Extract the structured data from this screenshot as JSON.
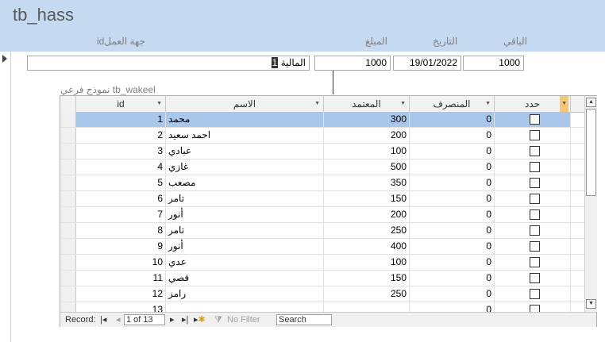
{
  "form": {
    "title": "tb_hass",
    "labels": {
      "id_entity": "جهة العملid",
      "amount": "المبلغ",
      "date": "التاريخ",
      "remaining": "الباقي"
    },
    "fields": {
      "id_value": "1",
      "entity_value": "المالية",
      "amount_value": "1000",
      "date_value": "19/01/2022",
      "remaining_value": "1000"
    }
  },
  "subform": {
    "label": "نموذج فرعي tb_wakeel",
    "columns": {
      "id": "id",
      "name": "الاسم",
      "approved": "المعتمد",
      "spent": "المنصرف",
      "select": "حدد"
    },
    "rows": [
      {
        "id": "1",
        "name": "محمد",
        "approved": "300",
        "spent": "0"
      },
      {
        "id": "2",
        "name": "احمد سعيد",
        "approved": "200",
        "spent": "0"
      },
      {
        "id": "3",
        "name": "عبادي",
        "approved": "100",
        "spent": "0"
      },
      {
        "id": "4",
        "name": "غازي",
        "approved": "500",
        "spent": "0"
      },
      {
        "id": "5",
        "name": "مصعب",
        "approved": "350",
        "spent": "0"
      },
      {
        "id": "6",
        "name": "تامر",
        "approved": "150",
        "spent": "0"
      },
      {
        "id": "7",
        "name": "أنور",
        "approved": "200",
        "spent": "0"
      },
      {
        "id": "8",
        "name": "تامر",
        "approved": "250",
        "spent": "0"
      },
      {
        "id": "9",
        "name": "أنور",
        "approved": "400",
        "spent": "0"
      },
      {
        "id": "10",
        "name": "عدي",
        "approved": "100",
        "spent": "0"
      },
      {
        "id": "11",
        "name": "قصي",
        "approved": "150",
        "spent": "0"
      },
      {
        "id": "12",
        "name": "رامز",
        "approved": "250",
        "spent": "0"
      },
      {
        "id": "13",
        "name": "",
        "approved": "",
        "spent": "0"
      }
    ]
  },
  "navigator": {
    "record_label": "Record:",
    "position": "1 of 13",
    "filter_label": "No Filter",
    "search_label": "Search"
  },
  "colors": {
    "header_band": "#c5d9f1",
    "selected_row": "#a9c7ea"
  }
}
